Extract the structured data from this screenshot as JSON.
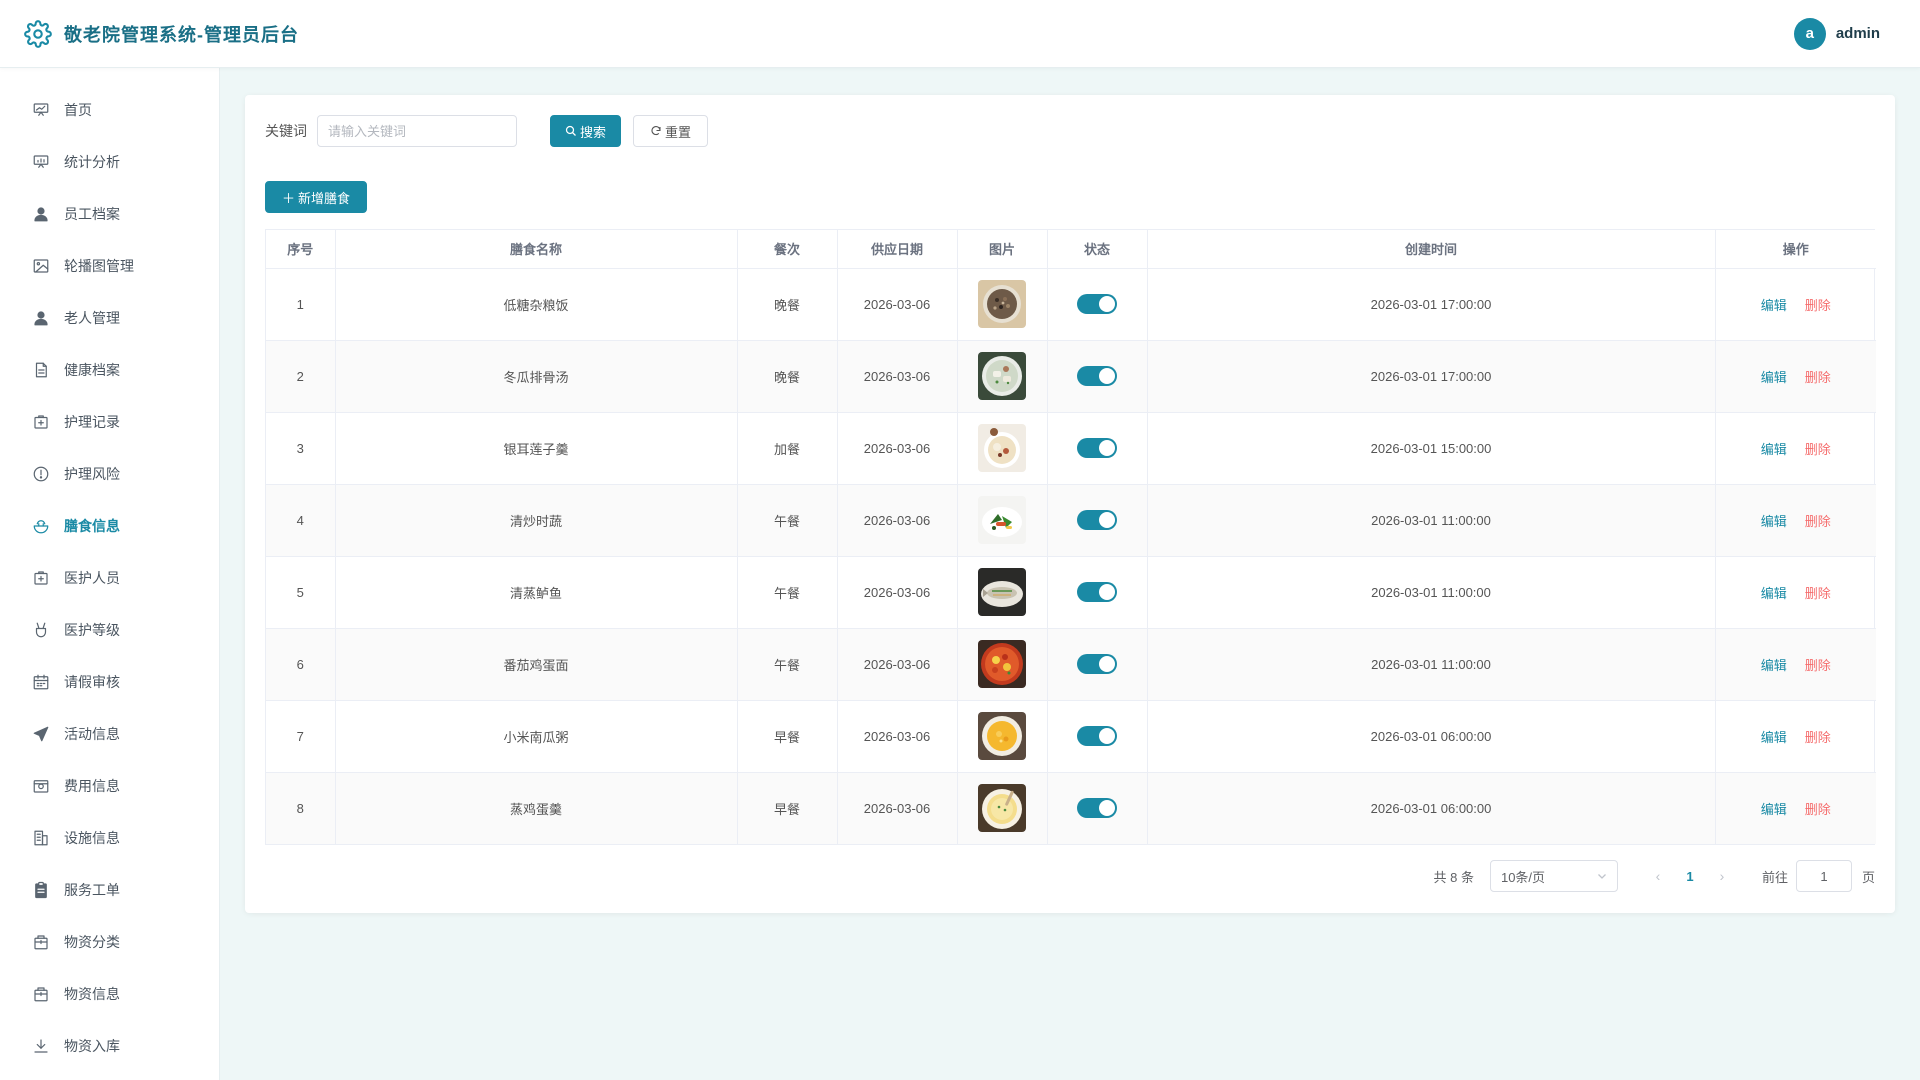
{
  "app": {
    "title": "敬老院管理系统-管理员后台",
    "user_initial": "a",
    "username": "admin",
    "accent_color": "#1a8aa5"
  },
  "sidebar": {
    "active_index": 8,
    "items": [
      {
        "label": "首页",
        "icon": "presentation-icon"
      },
      {
        "label": "统计分析",
        "icon": "chart-board-icon"
      },
      {
        "label": "员工档案",
        "icon": "user-icon"
      },
      {
        "label": "轮播图管理",
        "icon": "image-icon"
      },
      {
        "label": "老人管理",
        "icon": "user-icon"
      },
      {
        "label": "健康档案",
        "icon": "document-icon"
      },
      {
        "label": "护理记录",
        "icon": "first-aid-icon"
      },
      {
        "label": "护理风险",
        "icon": "warning-circle-icon"
      },
      {
        "label": "膳食信息",
        "icon": "bowl-icon"
      },
      {
        "label": "医护人员",
        "icon": "first-aid-icon"
      },
      {
        "label": "医护等级",
        "icon": "medal-icon"
      },
      {
        "label": "请假审核",
        "icon": "calendar-icon"
      },
      {
        "label": "活动信息",
        "icon": "send-icon"
      },
      {
        "label": "费用信息",
        "icon": "wallet-icon"
      },
      {
        "label": "设施信息",
        "icon": "building-icon"
      },
      {
        "label": "服务工单",
        "icon": "clipboard-icon"
      },
      {
        "label": "物资分类",
        "icon": "box-icon"
      },
      {
        "label": "物资信息",
        "icon": "box-icon"
      },
      {
        "label": "物资入库",
        "icon": "download-icon"
      }
    ]
  },
  "search": {
    "label": "关键词",
    "placeholder": "请输入关键词",
    "value": "",
    "search_button": "搜索",
    "reset_button": "重置"
  },
  "toolbar": {
    "add_button": "新增膳食"
  },
  "table": {
    "columns": [
      "序号",
      "膳食名称",
      "餐次",
      "供应日期",
      "图片",
      "状态",
      "创建时间",
      "操作"
    ],
    "edit_label": "编辑",
    "delete_label": "删除",
    "rows": [
      {
        "no": "1",
        "name": "低糖杂粮饭",
        "meal": "晚餐",
        "date": "2026-03-06",
        "image": "grain-rice-dish",
        "status": true,
        "created": "2026-03-01 17:00:00"
      },
      {
        "no": "2",
        "name": "冬瓜排骨汤",
        "meal": "晚餐",
        "date": "2026-03-06",
        "image": "winter-melon-soup",
        "status": true,
        "created": "2026-03-01 17:00:00"
      },
      {
        "no": "3",
        "name": "银耳莲子羹",
        "meal": "加餐",
        "date": "2026-03-06",
        "image": "tremella-soup",
        "status": true,
        "created": "2026-03-01 15:00:00"
      },
      {
        "no": "4",
        "name": "清炒时蔬",
        "meal": "午餐",
        "date": "2026-03-06",
        "image": "stir-fried-vegetables",
        "status": true,
        "created": "2026-03-01 11:00:00"
      },
      {
        "no": "5",
        "name": "清蒸鲈鱼",
        "meal": "午餐",
        "date": "2026-03-06",
        "image": "steamed-fish",
        "status": true,
        "created": "2026-03-01 11:00:00"
      },
      {
        "no": "6",
        "name": "番茄鸡蛋面",
        "meal": "午餐",
        "date": "2026-03-06",
        "image": "tomato-egg-noodles",
        "status": true,
        "created": "2026-03-01 11:00:00"
      },
      {
        "no": "7",
        "name": "小米南瓜粥",
        "meal": "早餐",
        "date": "2026-03-06",
        "image": "pumpkin-millet-porridge",
        "status": true,
        "created": "2026-03-01 06:00:00"
      },
      {
        "no": "8",
        "name": "蒸鸡蛋羹",
        "meal": "早餐",
        "date": "2026-03-06",
        "image": "steamed-egg-custard",
        "status": true,
        "created": "2026-03-01 06:00:00"
      }
    ]
  },
  "pagination": {
    "total_text": "共 8 条",
    "page_size": "10条/页",
    "current_page": "1",
    "goto_label": "前往",
    "goto_value": "1",
    "goto_suffix": "页"
  }
}
